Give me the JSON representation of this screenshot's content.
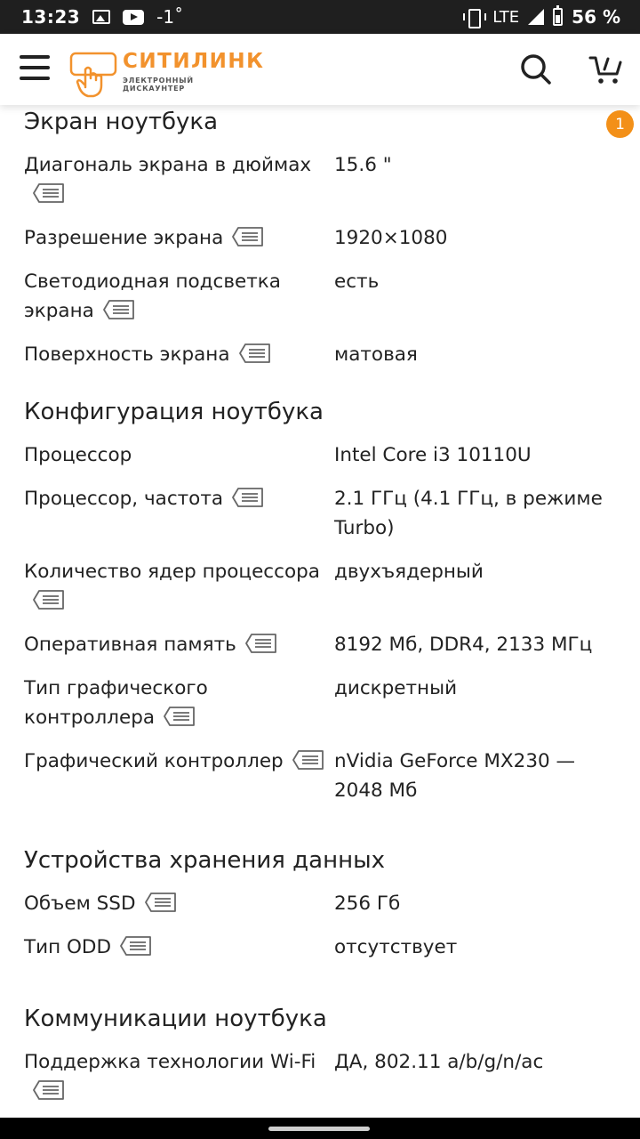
{
  "status_bar": {
    "time": "13:23",
    "temperature": "-1˚",
    "network": "LTE",
    "battery": "56 %",
    "icons": [
      "image-icon",
      "youtube-icon",
      "vibrate-icon",
      "signal-icon",
      "battery-icon"
    ]
  },
  "header": {
    "brand": "СИТИЛИНК",
    "tagline": "ЭЛЕКТРОННЫЙ ДИСКАУНТЕР",
    "cart_count": "1",
    "accent_color": "#f2922d",
    "badge_color": "#f39018"
  },
  "sections": [
    {
      "title": "Экран ноутбука",
      "rows": [
        {
          "label": "Диагональ экрана в дюймах",
          "value": "15.6 \""
        },
        {
          "label": "Разрешение экрана",
          "value": "1920×1080"
        },
        {
          "label": "Светодиодная подсветка экрана",
          "value": "есть"
        },
        {
          "label": "Поверхность экрана",
          "value": "матовая"
        }
      ]
    },
    {
      "title": "Конфигурация ноутбука",
      "rows": [
        {
          "label": "Процессор",
          "value": "Intel Core i3 10110U",
          "no_help": true
        },
        {
          "label": "Процессор, частота",
          "value": "2.1 ГГц (4.1 ГГц, в режиме Turbo)"
        },
        {
          "label": "Количество ядер процессора",
          "value": "двухъядерный"
        },
        {
          "label": "Оперативная память",
          "value": "8192 Мб, DDR4, 2133 МГц"
        },
        {
          "label": "Тип графического контроллера",
          "value": "дискретный"
        },
        {
          "label": "Графический контроллер",
          "value": "nVidia GeForce MX230 — 2048 Мб"
        }
      ]
    },
    {
      "title": "Устройства хранения данных",
      "rows": [
        {
          "label": "Объем SSD",
          "value": "256 Гб"
        },
        {
          "label": "Тип ODD",
          "value": "отсутствует"
        }
      ]
    },
    {
      "title": "Коммуникации ноутбука",
      "rows": [
        {
          "label": "Поддержка технологии Wi-Fi",
          "value": "ДА, 802.11 a/b/g/n/ac"
        }
      ]
    }
  ]
}
